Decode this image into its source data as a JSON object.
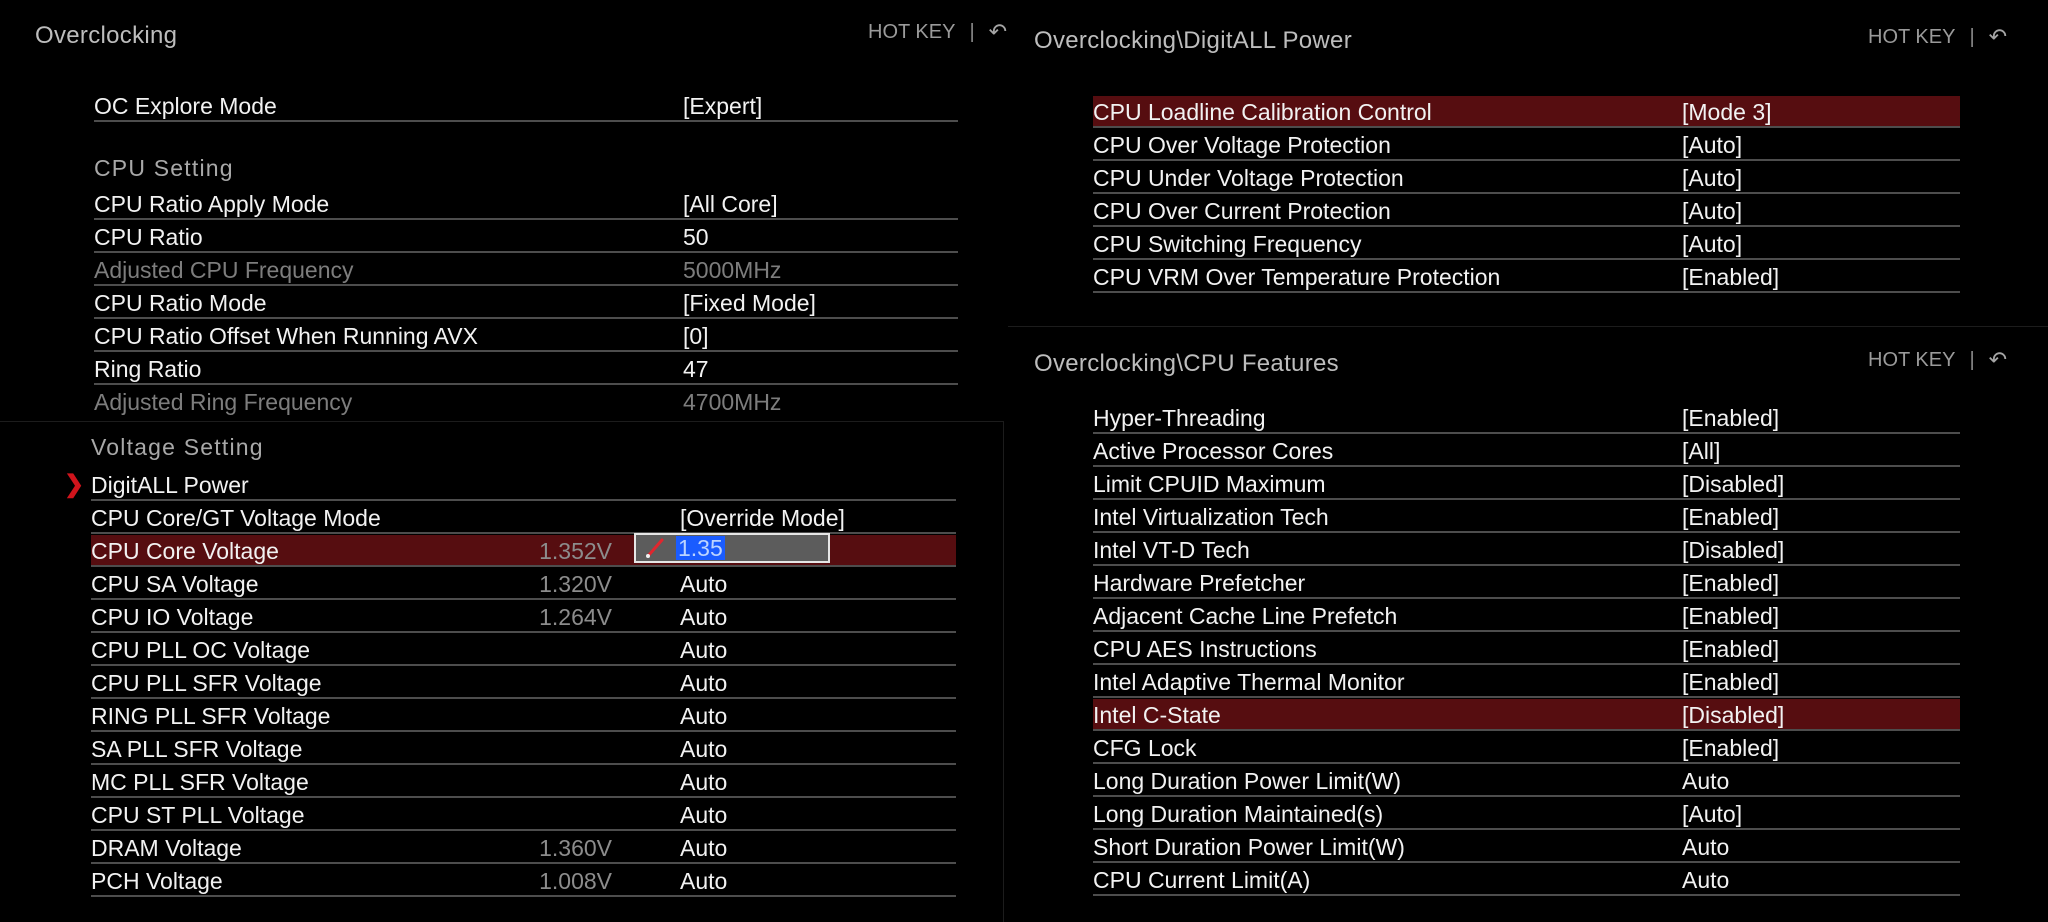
{
  "hotkey_label": "HOT KEY",
  "hotkey_separator": "|",
  "colors": {
    "highlight": "#560d10",
    "accent_red": "#d0141c",
    "selection_blue": "#1a5cff"
  },
  "left_top": {
    "title": "Overclocking",
    "rows_top": [
      {
        "label": "OC Explore Mode",
        "value": "[Expert]"
      }
    ],
    "cpu_section_title": "CPU  Setting",
    "cpu_rows": [
      {
        "label": "CPU Ratio Apply Mode",
        "value": "[All Core]"
      },
      {
        "label": "CPU Ratio",
        "value": "50"
      },
      {
        "label": "Adjusted CPU Frequency",
        "value": "5000MHz",
        "disabled": true
      },
      {
        "label": "CPU Ratio Mode",
        "value": "[Fixed Mode]"
      },
      {
        "label": "CPU Ratio Offset When Running AVX",
        "value": "[0]"
      },
      {
        "label": "Ring Ratio",
        "value": "47"
      },
      {
        "label": "Adjusted Ring Frequency",
        "value": "4700MHz",
        "disabled": true
      }
    ]
  },
  "left_bottom": {
    "voltage_section_title": "Voltage  Setting",
    "submenu": {
      "label": "DigitALL Power",
      "icon": "chevron-right-icon"
    },
    "rows": [
      {
        "label": "CPU Core/GT Voltage Mode",
        "readout": "",
        "value": "[Override Mode]"
      },
      {
        "label": "CPU Core Voltage",
        "readout": "1.352V",
        "value": "1.35",
        "selected": true,
        "editing": true
      },
      {
        "label": "CPU SA Voltage",
        "readout": "1.320V",
        "value": "Auto"
      },
      {
        "label": "CPU IO Voltage",
        "readout": "1.264V",
        "value": "Auto"
      },
      {
        "label": "CPU PLL OC Voltage",
        "readout": "",
        "value": "Auto"
      },
      {
        "label": "CPU PLL SFR Voltage",
        "readout": "",
        "value": "Auto"
      },
      {
        "label": "RING PLL SFR Voltage",
        "readout": "",
        "value": "Auto"
      },
      {
        "label": "SA PLL SFR Voltage",
        "readout": "",
        "value": "Auto"
      },
      {
        "label": "MC PLL SFR Voltage",
        "readout": "",
        "value": "Auto"
      },
      {
        "label": "CPU ST PLL Voltage",
        "readout": "",
        "value": "Auto"
      },
      {
        "label": "DRAM Voltage",
        "readout": "1.360V",
        "value": "Auto"
      },
      {
        "label": "PCH Voltage",
        "readout": "1.008V",
        "value": "Auto"
      }
    ]
  },
  "right_top": {
    "title": "Overclocking\\DigitALL Power",
    "rows": [
      {
        "label": "CPU Loadline Calibration Control",
        "value": "[Mode 3]",
        "selected": true
      },
      {
        "label": "CPU Over Voltage Protection",
        "value": "[Auto]"
      },
      {
        "label": "CPU Under Voltage Protection",
        "value": "[Auto]"
      },
      {
        "label": "CPU Over Current Protection",
        "value": "[Auto]"
      },
      {
        "label": "CPU Switching Frequency",
        "value": "[Auto]"
      },
      {
        "label": "CPU VRM Over Temperature Protection",
        "value": "[Enabled]"
      }
    ]
  },
  "right_bottom": {
    "title": "Overclocking\\CPU Features",
    "rows": [
      {
        "label": "Hyper-Threading",
        "value": "[Enabled]"
      },
      {
        "label": "Active Processor Cores",
        "value": "[All]"
      },
      {
        "label": "Limit CPUID Maximum",
        "value": "[Disabled]"
      },
      {
        "label": "Intel Virtualization Tech",
        "value": "[Enabled]"
      },
      {
        "label": "Intel VT-D Tech",
        "value": "[Disabled]"
      },
      {
        "label": "Hardware Prefetcher",
        "value": "[Enabled]"
      },
      {
        "label": "Adjacent Cache Line Prefetch",
        "value": "[Enabled]"
      },
      {
        "label": "CPU AES Instructions",
        "value": "[Enabled]"
      },
      {
        "label": "Intel Adaptive Thermal Monitor",
        "value": "[Enabled]"
      },
      {
        "label": "Intel C-State",
        "value": "[Disabled]",
        "selected": true
      },
      {
        "label": "CFG Lock",
        "value": "[Enabled]"
      },
      {
        "label": "Long Duration Power Limit(W)",
        "value": "Auto"
      },
      {
        "label": "Long Duration Maintained(s)",
        "value": "[Auto]"
      },
      {
        "label": "Short Duration Power Limit(W)",
        "value": "Auto"
      },
      {
        "label": "CPU Current Limit(A)",
        "value": "Auto"
      }
    ]
  }
}
